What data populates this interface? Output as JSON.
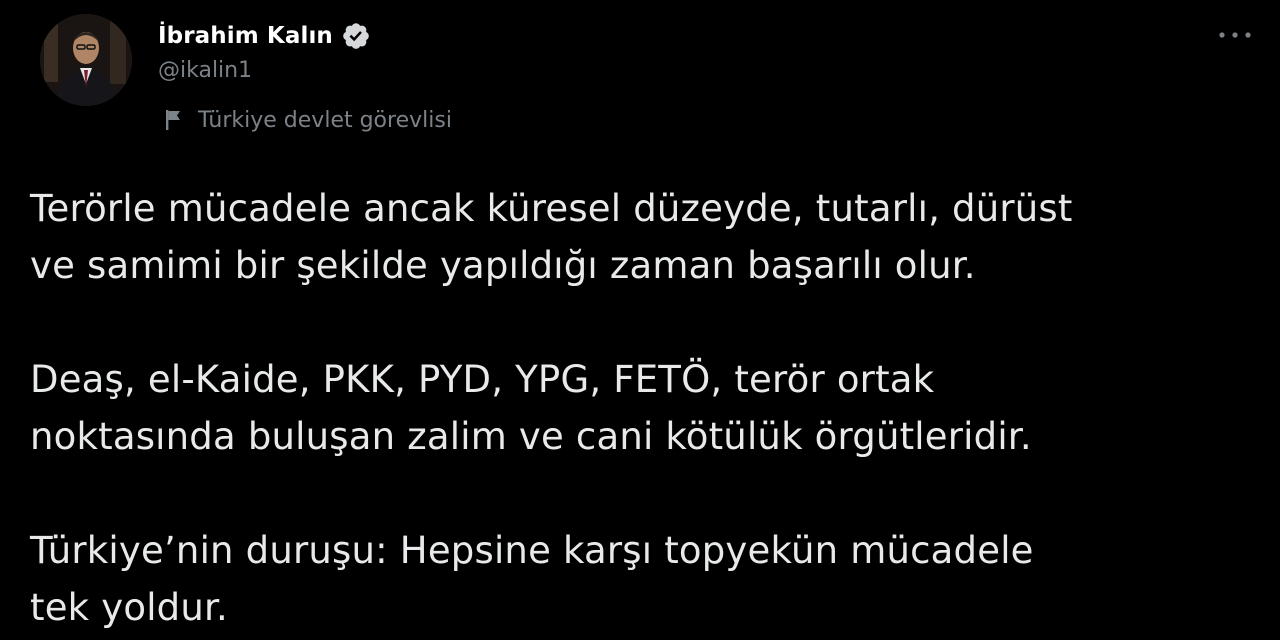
{
  "author": {
    "display_name": "İbrahim Kalın",
    "handle": "@ikalin1",
    "verified": true,
    "label": "Türkiye devlet görevlisi"
  },
  "icons": {
    "verified": "verified-badge-icon",
    "label": "flag-icon",
    "more": "more-options-icon"
  },
  "tweet": {
    "paragraphs": [
      [
        "Terörle mücadele ancak küresel düzeyde, tutarlı, dürüst",
        "ve samimi bir şekilde yapıldığı zaman başarılı olur."
      ],
      [
        "Deaş, el-Kaide, PKK, PYD, YPG, FETÖ, terör ortak",
        "noktasında buluşan zalim ve cani kötülük örgütleridir."
      ],
      [
        "Türkiye’nin duruşu: Hepsine karşı topyekün mücadele",
        "tek yoldur."
      ]
    ]
  },
  "colors": {
    "background": "#000000",
    "text": "#e7e9ea",
    "muted": "#7b8288"
  }
}
